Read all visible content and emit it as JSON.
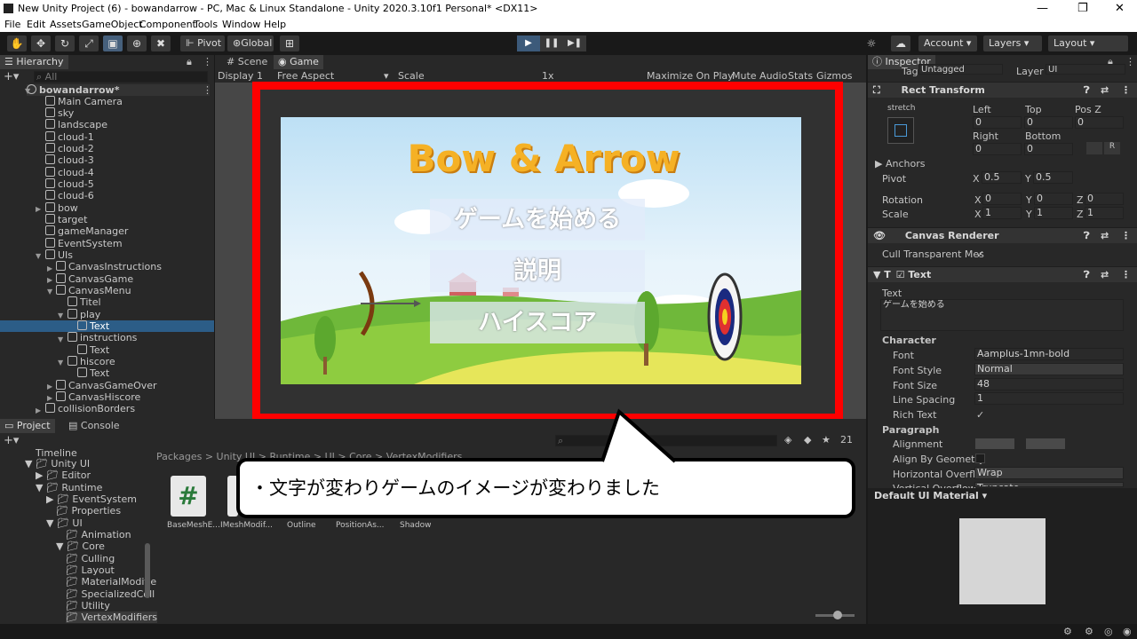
{
  "window": {
    "title": "New Unity Project (6) - bowandarrow - PC, Mac & Linux Standalone - Unity 2020.3.10f1 Personal* <DX11>"
  },
  "menu": [
    "File",
    "Edit",
    "Assets",
    "GameObject",
    "Component",
    "Tools",
    "Window",
    "Help"
  ],
  "toolbar": {
    "pivot": "Pivot",
    "global": "Global",
    "account": "Account",
    "layers": "Layers",
    "layout": "Layout"
  },
  "hierarchy": {
    "tab": "Hierarchy",
    "search_placeholder": "All",
    "scene": "bowandarrow*",
    "items": [
      "Main Camera",
      "sky",
      "landscape",
      "cloud-1",
      "cloud-2",
      "cloud-3",
      "cloud-4",
      "cloud-5",
      "cloud-6",
      "bow",
      "target",
      "gameManager",
      "EventSystem",
      "UIs",
      "CanvasInstructions",
      "CanvasGame",
      "CanvasMenu",
      "Titel",
      "play",
      "Text",
      "instructions",
      "Text",
      "hiscore",
      "Text",
      "CanvasGameOver",
      "CanvasHiscore",
      "collisionBorders"
    ]
  },
  "game": {
    "tabs": [
      "Scene",
      "Game"
    ],
    "display": "Display 1",
    "aspect": "Free Aspect",
    "scale_label": "Scale",
    "scale_value": "1x",
    "options": [
      "Maximize On Play",
      "Mute Audio",
      "Stats",
      "Gizmos"
    ],
    "title": "Bow & Arrow",
    "buttons": [
      "ゲームを始める",
      "説明",
      "ハイスコア"
    ]
  },
  "project": {
    "tabs": [
      "Project",
      "Console"
    ],
    "breadcrumb": "Packages > Unity UI > Runtime > UI > Core > VertexModifiers",
    "tree": [
      "Timeline",
      "Unity UI",
      "Editor",
      "Runtime",
      "EventSystem",
      "Properties",
      "UI",
      "Animation",
      "Core",
      "Culling",
      "Layout",
      "MaterialModifie",
      "SpecializedColl",
      "Utility",
      "VertexModifiers"
    ],
    "assets": [
      "BaseMeshE...",
      "IMeshModif...",
      "Outline",
      "PositionAs...",
      "Shadow"
    ],
    "hidden_count": "21"
  },
  "inspector": {
    "tab": "Inspector",
    "tag_label": "Tag",
    "tag_value": "Untagged",
    "layer_label": "Layer",
    "layer_value": "UI",
    "rect": {
      "title": "Rect Transform",
      "stretch": "stretch",
      "left_label": "Left",
      "top_label": "Top",
      "posz_label": "Pos Z",
      "left": "0",
      "top": "0",
      "posz": "0",
      "right_label": "Right",
      "bottom_label": "Bottom",
      "right": "0",
      "bottom": "0",
      "anchors": "Anchors",
      "pivot_label": "Pivot",
      "pivot_x": "0.5",
      "pivot_y": "0.5",
      "rotation_label": "Rotation",
      "rot_x": "0",
      "rot_y": "0",
      "rot_z": "0",
      "scale_label": "Scale",
      "scale_x": "1",
      "scale_y": "1",
      "scale_z": "1"
    },
    "canvas_renderer": {
      "title": "Canvas Renderer",
      "cull_label": "Cull Transparent Mes"
    },
    "text": {
      "title": "Text",
      "text_label": "Text",
      "text_value": "ゲームを始める",
      "character": "Character",
      "font_label": "Font",
      "font_value": "mplus-1mn-bold",
      "style_label": "Font Style",
      "style_value": "Normal",
      "size_label": "Font Size",
      "size_value": "48",
      "spacing_label": "Line Spacing",
      "spacing_value": "1",
      "rich_label": "Rich Text",
      "paragraph": "Paragraph",
      "align_label": "Alignment",
      "geom_label": "Align By Geometry",
      "hover_label": "Horizontal Overflo",
      "hover_value": "Wrap",
      "vover_label": "Vertical Overflow",
      "vover_value": "Truncate"
    },
    "material": "Default UI Material"
  },
  "callout": {
    "text": "・文字が変わりゲームのイメージが変わりました"
  }
}
